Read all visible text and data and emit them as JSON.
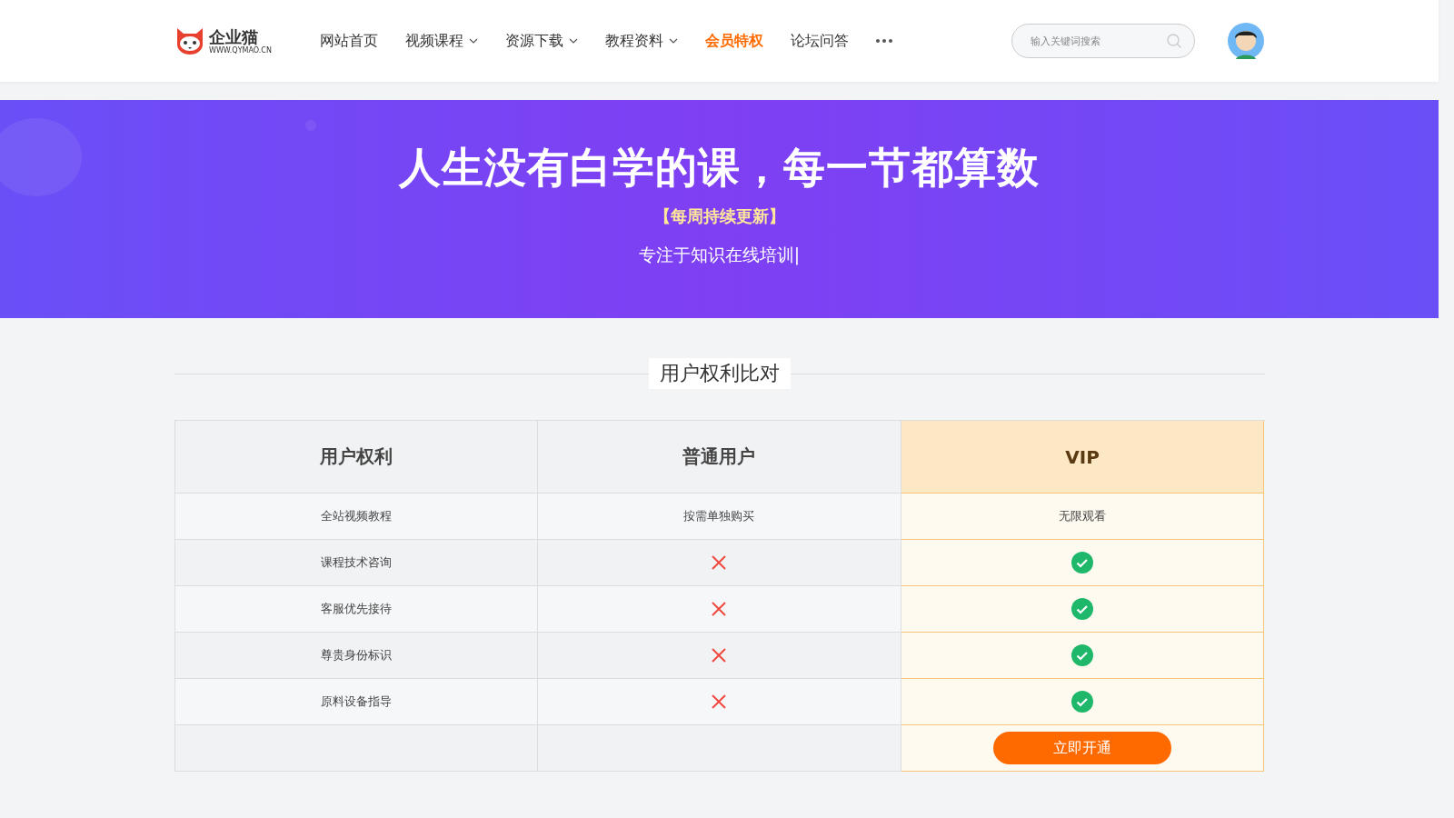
{
  "header": {
    "logo": {
      "name": "企业猫",
      "url": "WWW.QYMAO.CN"
    },
    "nav": [
      {
        "label": "网站首页",
        "dropdown": false,
        "selected": false
      },
      {
        "label": "视频课程",
        "dropdown": true,
        "selected": false
      },
      {
        "label": "资源下载",
        "dropdown": true,
        "selected": false
      },
      {
        "label": "教程资料",
        "dropdown": true,
        "selected": false
      },
      {
        "label": "会员特权",
        "dropdown": false,
        "selected": true
      },
      {
        "label": "论坛问答",
        "dropdown": false,
        "selected": false
      }
    ],
    "search": {
      "placeholder": "输入关键词搜索"
    }
  },
  "banner": {
    "title": "人生没有白学的课，每一节都算数",
    "subtitle": "【每周持续更新】",
    "tagline": "专注于知识在线培训|"
  },
  "comparison": {
    "title": "用户权利比对",
    "columns": [
      {
        "label": "用户权利",
        "highlight": false
      },
      {
        "label": "普通用户",
        "highlight": false
      },
      {
        "label": "VIP",
        "highlight": true
      }
    ],
    "rows": [
      [
        {
          "kind": "text",
          "text": "全站视频教程"
        },
        {
          "kind": "text",
          "text": "按需单独购买"
        },
        {
          "kind": "text",
          "text": "无限观看"
        }
      ],
      [
        {
          "kind": "text",
          "text": "课程技术咨询"
        },
        {
          "kind": "cross"
        },
        {
          "kind": "check"
        }
      ],
      [
        {
          "kind": "text",
          "text": "客服优先接待"
        },
        {
          "kind": "cross"
        },
        {
          "kind": "check"
        }
      ],
      [
        {
          "kind": "text",
          "text": "尊贵身份标识"
        },
        {
          "kind": "cross"
        },
        {
          "kind": "check"
        }
      ],
      [
        {
          "kind": "text",
          "text": "原料设备指导"
        },
        {
          "kind": "cross"
        },
        {
          "kind": "check"
        }
      ],
      [
        {
          "kind": "empty"
        },
        {
          "kind": "empty"
        },
        {
          "kind": "button",
          "text": "立即开通"
        }
      ]
    ]
  }
}
